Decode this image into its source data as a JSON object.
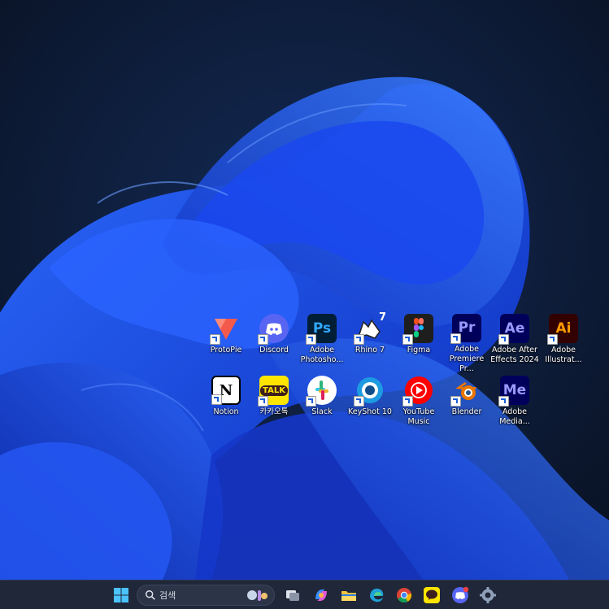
{
  "desktop": {
    "icons_row1": [
      {
        "label": "ProtoPie",
        "icon": "protopie-icon"
      },
      {
        "label": "Discord",
        "icon": "discord-icon"
      },
      {
        "label": "Adobe Photosho...",
        "icon": "photoshop-icon",
        "abbr": "Ps"
      },
      {
        "label": "Rhino 7",
        "icon": "rhino-icon",
        "abbr": "7"
      },
      {
        "label": "Figma",
        "icon": "figma-icon"
      },
      {
        "label": "Adobe Premiere Pr...",
        "icon": "premiere-icon",
        "abbr": "Pr"
      },
      {
        "label": "Adobe After Effects 2024",
        "icon": "after-effects-icon",
        "abbr": "Ae"
      },
      {
        "label": "Adobe Illustrat...",
        "icon": "illustrator-icon",
        "abbr": "Ai"
      }
    ],
    "icons_row2": [
      {
        "label": "Notion",
        "icon": "notion-icon",
        "abbr": "N"
      },
      {
        "label": "카카오톡",
        "icon": "kakaotalk-icon",
        "abbr": "TALK"
      },
      {
        "label": "Slack",
        "icon": "slack-icon"
      },
      {
        "label": "KeyShot 10",
        "icon": "keyshot-icon"
      },
      {
        "label": "YouTube Music",
        "icon": "youtube-music-icon"
      },
      {
        "label": "Blender",
        "icon": "blender-icon"
      },
      {
        "label": "Adobe Media...",
        "icon": "media-encoder-icon",
        "abbr": "Me"
      }
    ]
  },
  "taskbar": {
    "search_placeholder": "검색",
    "items": [
      "windows-start-icon",
      "search-icon",
      "task-view-icon",
      "copilot-icon",
      "file-explorer-icon",
      "edge-icon",
      "chrome-icon",
      "kakaotalk-icon",
      "discord-icon",
      "settings-icon"
    ]
  },
  "colors": {
    "taskbar": "#1f2738",
    "wallpaper_dark": "#0c1a33",
    "wallpaper_blue": "#1f4fe0"
  }
}
